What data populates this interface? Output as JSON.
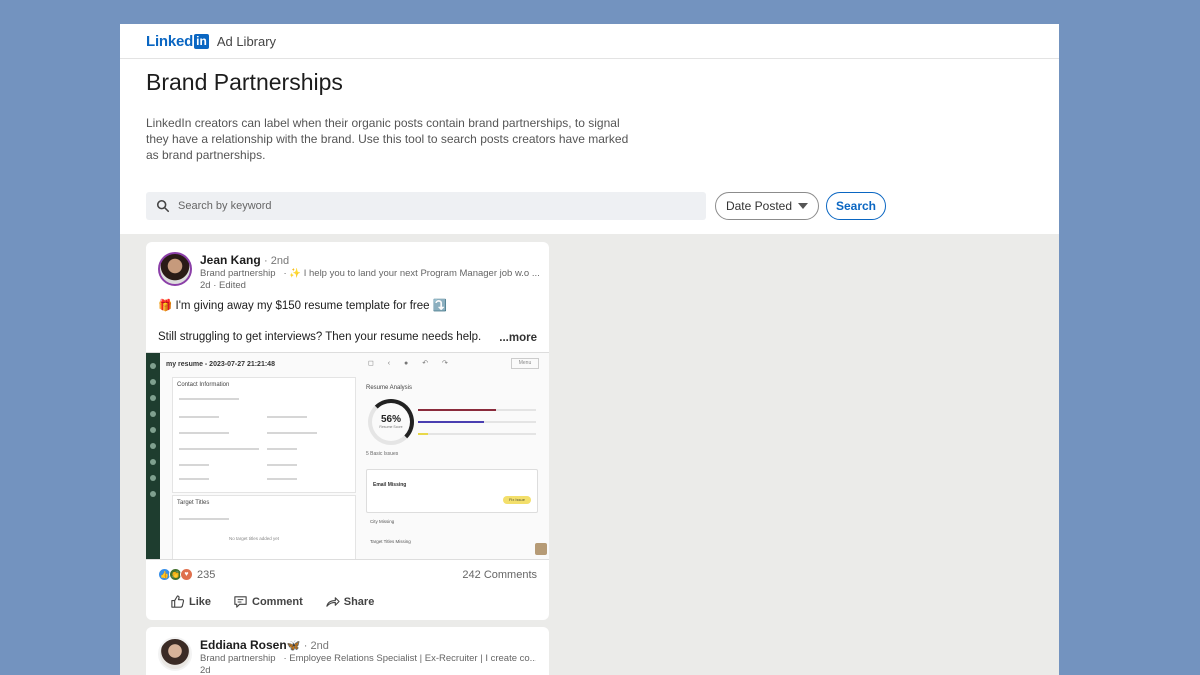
{
  "header": {
    "logo_text": "Linked",
    "logo_in": "in",
    "product": "Ad Library"
  },
  "page": {
    "title": "Brand Partnerships",
    "description": "LinkedIn creators can label when their organic posts contain brand partnerships, to signal they have a relationship with the brand. Use this tool to search posts creators have marked as brand partnerships."
  },
  "search": {
    "placeholder": "Search by keyword",
    "value": "",
    "date_filter": "Date Posted",
    "button": "Search"
  },
  "posts": [
    {
      "author": "Jean Kang",
      "degree": "· 2nd",
      "tag": "Brand partnership",
      "headline": "·  ✨ I help you to land your next Program Manager job w.o ...",
      "time": "2d  ·  Edited",
      "line1": "🎁 I'm giving away my $150 resume template for free ⤵️",
      "line2": "Still struggling to get interviews? Then your resume needs help.",
      "more": "...more",
      "media": {
        "doc_title": "my resume - 2023-07-27 21:21:48",
        "menu": "Menu",
        "section1": "Contact Information",
        "section2": "Target Titles",
        "empty_note": "No target titles added yet",
        "analysis_title": "Resume Analysis",
        "score": "56%",
        "score_sub": "Resume Score",
        "issues": "5 Basic Issues",
        "issue_name": "Email Missing",
        "issue_button": "Fix Issue",
        "row1": "City Missing",
        "row2": "Target Titles Missing"
      },
      "reaction_count": "235",
      "comments": "242 Comments",
      "actions": {
        "like": "Like",
        "comment": "Comment",
        "share": "Share"
      }
    },
    {
      "author": "Eddiana Rosen",
      "degree": "· 2nd",
      "tag": "Brand partnership",
      "headline": "·  Employee Relations Specialist | Ex-Recruiter | I create co...",
      "time": "2d"
    }
  ],
  "colors": {
    "brand": "#0a66c2",
    "background": "#7393bf",
    "feed": "#ebebe9"
  }
}
